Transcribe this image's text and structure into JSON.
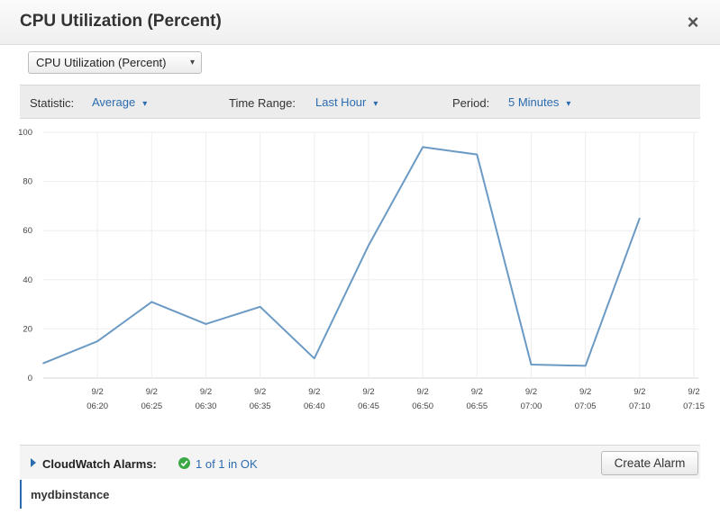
{
  "window": {
    "title": "CPU Utilization (Percent)",
    "close_icon": "×"
  },
  "metric_select": {
    "value": "CPU Utilization (Percent)",
    "chevron": "▾"
  },
  "options": {
    "statistic_label": "Statistic:",
    "statistic_value": "Average",
    "time_range_label": "Time Range:",
    "time_range_value": "Last Hour",
    "period_label": "Period:",
    "period_value": "5 Minutes",
    "chevron": "▾"
  },
  "chart_data": {
    "type": "line",
    "title": "",
    "xlabel": "",
    "ylabel": "",
    "ylim": [
      0,
      100
    ],
    "yticks": [
      0,
      20,
      40,
      60,
      80,
      100
    ],
    "xtick_dates": [
      "9/2",
      "9/2",
      "9/2",
      "9/2",
      "9/2",
      "9/2",
      "9/2",
      "9/2",
      "9/2",
      "9/2",
      "9/2",
      "9/2"
    ],
    "xtick_times": [
      "06:20",
      "06:25",
      "06:30",
      "06:35",
      "06:40",
      "06:45",
      "06:50",
      "06:55",
      "07:00",
      "07:05",
      "07:10",
      "07:15"
    ],
    "xlim": [
      "06:15",
      "07:15"
    ],
    "grid": true,
    "line_color": "#6b9ac4",
    "series": [
      {
        "x": [
          "06:15",
          "06:20",
          "06:25",
          "06:30",
          "06:35",
          "06:40",
          "06:45",
          "06:50",
          "06:55",
          "07:00",
          "07:05",
          "07:10"
        ],
        "values": [
          6,
          15,
          31,
          22,
          29,
          8,
          54,
          94,
          91,
          5.5,
          5,
          65
        ]
      }
    ]
  },
  "alarms": {
    "label": "CloudWatch Alarms:",
    "status": "1 of 1 in OK",
    "status_color": "#3aa843",
    "create_button": "Create Alarm"
  },
  "instance": {
    "name": "mydbinstance"
  }
}
